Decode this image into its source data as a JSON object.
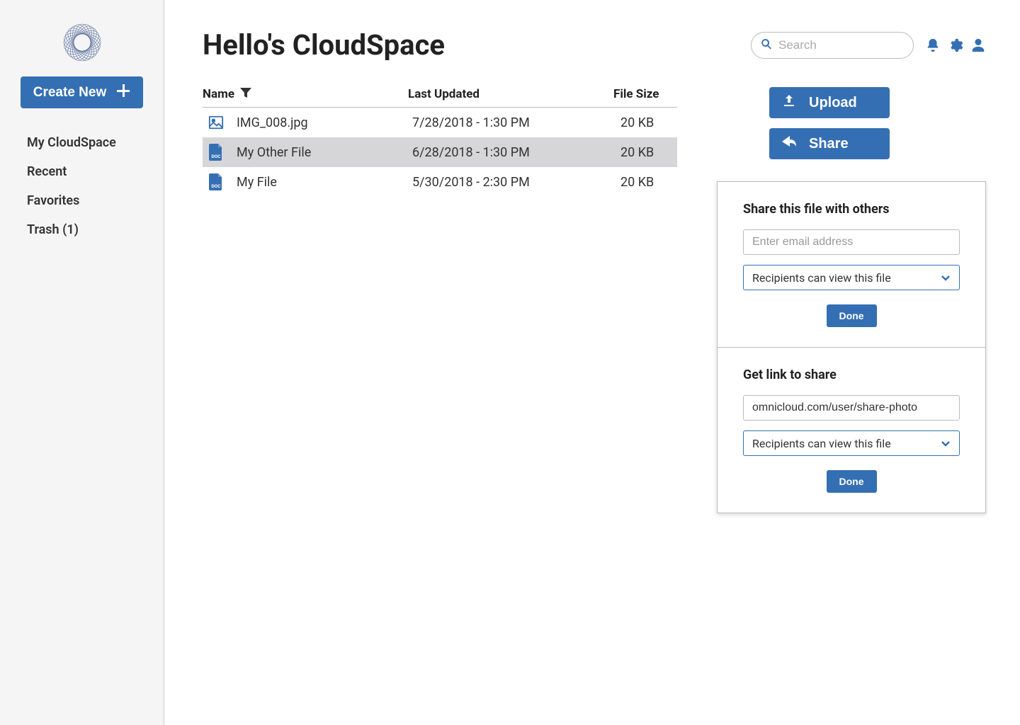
{
  "sidebar": {
    "create_label": "Create New",
    "nav": [
      "My CloudSpace",
      "Recent",
      "Favorites",
      "Trash (1)"
    ]
  },
  "header": {
    "title": "Hello's CloudSpace",
    "search_placeholder": "Search"
  },
  "table": {
    "columns": {
      "name": "Name",
      "updated": "Last Updated",
      "size": "File Size"
    },
    "rows": [
      {
        "icon": "image",
        "name": "IMG_008.jpg",
        "updated": "7/28/2018 - 1:30 PM",
        "size": "20 KB",
        "selected": false
      },
      {
        "icon": "doc",
        "name": "My Other File",
        "updated": "6/28/2018 - 1:30 PM",
        "size": "20 KB",
        "selected": true
      },
      {
        "icon": "doc",
        "name": "My File",
        "updated": "5/30/2018 - 2:30 PM",
        "size": "20 KB",
        "selected": false
      }
    ]
  },
  "actions": {
    "upload": "Upload",
    "share": "Share"
  },
  "share_panel": {
    "share_title": "Share this file with others",
    "email_placeholder": "Enter email address",
    "perm_label": "Recipients can view this file",
    "done": "Done",
    "link_title": "Get link to share",
    "link_value": "omnicloud.com/user/share-photo"
  }
}
